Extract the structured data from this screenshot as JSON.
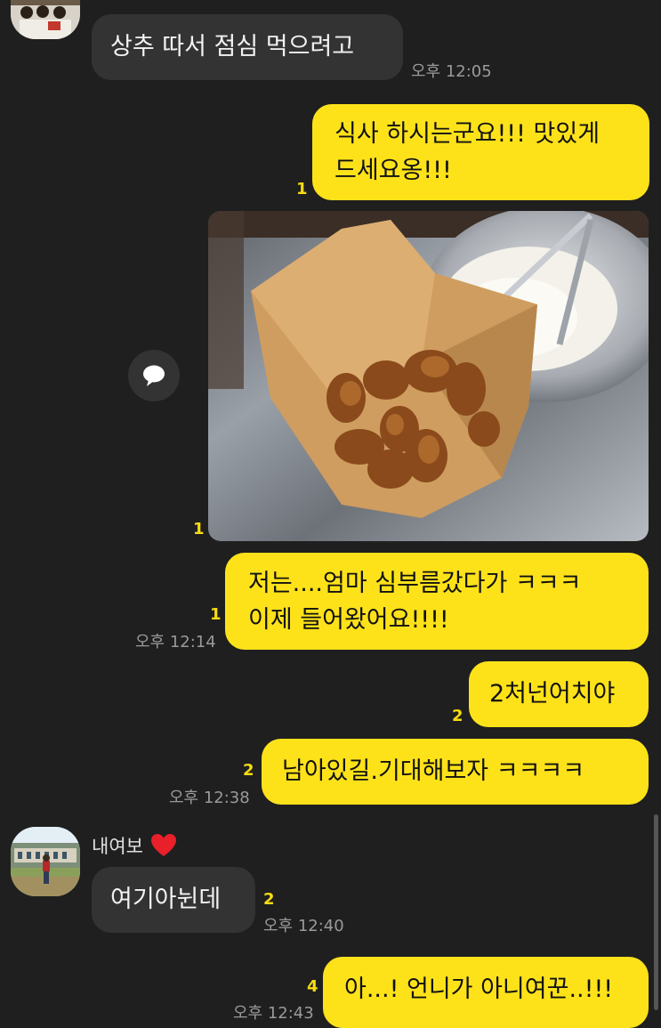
{
  "colors": {
    "background": "#1f1f1f",
    "incoming_bubble": "#333333",
    "outgoing_bubble": "#fde21a",
    "unread_count": "#f5dc12",
    "timestamp": "#9a9a9a"
  },
  "messages": [
    {
      "direction": "in",
      "text": "상추 따서 점심 먹으려고",
      "time": "오후 12:05"
    },
    {
      "direction": "out",
      "lines": [
        "식사 하시는군요!!! 맛있게",
        "드세요옹!!!"
      ],
      "unread": "1"
    },
    {
      "direction": "out",
      "type": "photo",
      "unread": "1",
      "share_icon": "speech-bubble-icon"
    },
    {
      "direction": "out",
      "lines": [
        "저는....엄마 심부름갔다가 ㅋㅋㅋ",
        "이제 들어왔어요!!!!"
      ],
      "unread": "1",
      "time": "오후 12:14"
    },
    {
      "direction": "out",
      "text": "2처넌어치야",
      "unread": "2"
    },
    {
      "direction": "out",
      "text": "남아있길.기대해보자 ㅋㅋㅋㅋ",
      "unread": "2",
      "time": "오후 12:38"
    },
    {
      "direction": "in",
      "sender": "내여보",
      "sender_emoji": "heart-icon",
      "text": "여기아뉜데",
      "unread": "2",
      "time": "오후 12:40"
    },
    {
      "direction": "out",
      "text": "아...! 언니가 아니여꾼..!!!",
      "unread": "4",
      "time": "오후 12:43"
    }
  ]
}
